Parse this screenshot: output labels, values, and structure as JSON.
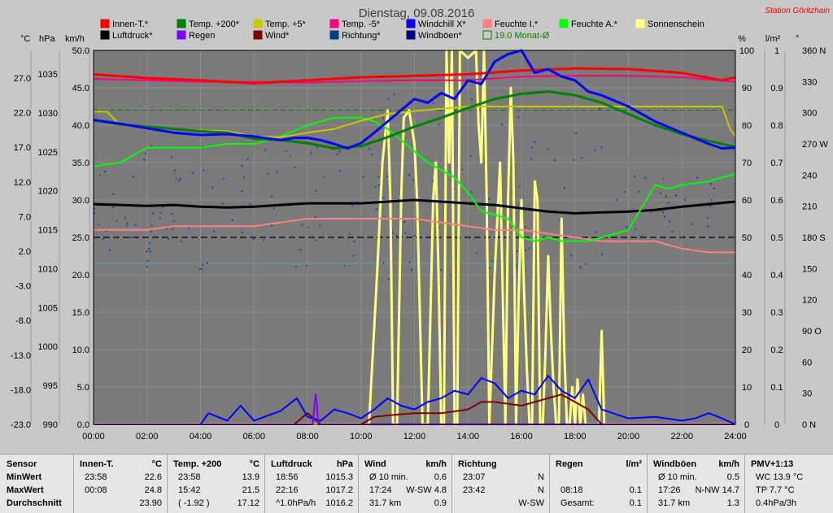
{
  "chart_data": {
    "type": "line",
    "title": "Dienstag, 09.08.2016",
    "station": "Station Göritzhain",
    "x_ticks": [
      "00:00",
      "02:00",
      "04:00",
      "06:00",
      "08:00",
      "10:00",
      "12:00",
      "14:00",
      "16:00",
      "18:00",
      "20:00",
      "22:00",
      "24:00"
    ],
    "axes": {
      "celsius": {
        "unit": "°C",
        "ticks": [
          "27.0",
          "22.0",
          "17.0",
          "12.0",
          "7.0",
          "2.0",
          "-3.0",
          "-8.0",
          "-13.0",
          "-18.0",
          "-23.0"
        ]
      },
      "hpa": {
        "unit": "hPa",
        "ticks": [
          "1035",
          "1030",
          "1025",
          "1020",
          "1015",
          "1010",
          "1005",
          "1000",
          "995",
          "990"
        ]
      },
      "kmh": {
        "unit": "km/h",
        "ticks": [
          "50.0",
          "45.0",
          "40.0",
          "35.0",
          "30.0",
          "25.0",
          "20.0",
          "15.0",
          "10.0",
          "5.0",
          "0.0"
        ]
      },
      "percent": {
        "unit": "%",
        "ticks": [
          "100",
          "90",
          "80",
          "70",
          "60",
          "50",
          "40",
          "30",
          "20",
          "10",
          "0"
        ]
      },
      "rain": {
        "unit": "l/m²",
        "ticks": [
          "1",
          "0.9",
          "0.8",
          "0.7",
          "0.6",
          "0.5",
          "0.4",
          "0.3",
          "0.2",
          "0.1",
          "0"
        ]
      },
      "direction": {
        "unit": "°",
        "ticks": [
          "360 N",
          "330",
          "300",
          "270 W",
          "240",
          "210",
          "180 S",
          "150",
          "120",
          "90 O",
          "60",
          "30",
          "0 N"
        ]
      }
    },
    "legend": [
      {
        "name": "Innen-T.*",
        "color": "#ff0000"
      },
      {
        "name": "Temp. +200*",
        "color": "#008000"
      },
      {
        "name": "Temp. +5*",
        "color": "#c8c800"
      },
      {
        "name": "Temp. -5*",
        "color": "#ff0080"
      },
      {
        "name": "Windchill X*",
        "color": "#0000ff"
      },
      {
        "name": "Feuchte I.*",
        "color": "#ff8080"
      },
      {
        "name": "Feuchte A.*",
        "color": "#00ff00"
      },
      {
        "name": "Sonnenschein",
        "color": "#ffff80"
      },
      {
        "name": "Luftdruck*",
        "color": "#000000"
      },
      {
        "name": "Regen",
        "color": "#8000ff"
      },
      {
        "name": "Wind*",
        "color": "#800000"
      },
      {
        "name": "Richtung*",
        "color": "#004080"
      },
      {
        "name": "Windböen*",
        "color": "#000080"
      },
      {
        "name": "19.0 Monat-Ø",
        "color": "#008000"
      }
    ],
    "series": [
      {
        "name": "Innen-T.*",
        "axis": "celsius",
        "color": "#ff0000",
        "x": [
          0,
          2,
          4,
          6,
          8,
          10,
          12,
          14,
          16,
          18,
          20,
          22,
          23.5,
          24
        ],
        "values": [
          23.8,
          23.3,
          23.0,
          22.6,
          23.0,
          23.4,
          23.6,
          23.8,
          24.3,
          24.6,
          24.5,
          24.0,
          23.0,
          23.4
        ]
      },
      {
        "name": "Temp. -5*",
        "axis": "celsius",
        "color": "#ff0080",
        "x": [
          0,
          2,
          4,
          6,
          8,
          10,
          12,
          14,
          16,
          18,
          20,
          22,
          24
        ],
        "values": [
          23.2,
          23.0,
          22.8,
          22.8,
          22.7,
          22.9,
          23.0,
          23.0,
          23.5,
          23.6,
          23.6,
          23.4,
          22.8
        ]
      },
      {
        "name": "Temp. +5*",
        "axis": "celsius",
        "color": "#c8c800",
        "x": [
          0,
          0.5,
          1,
          2,
          3,
          4,
          5,
          6,
          7,
          8,
          9,
          10,
          11,
          12,
          13,
          14,
          15,
          16,
          17,
          18,
          19,
          20,
          21,
          22,
          23.5,
          23.8,
          24
        ],
        "values": [
          18.8,
          18.8,
          17.0,
          16.8,
          16.5,
          16.3,
          16.2,
          15.5,
          15.4,
          16.0,
          16.5,
          17.6,
          18.5,
          18.9,
          19.2,
          19.5,
          19.5,
          19.5,
          19.5,
          19.5,
          19.5,
          19.5,
          19.5,
          19.5,
          19.5,
          16.5,
          15.5
        ]
      },
      {
        "name": "Temp. +200*",
        "axis": "celsius",
        "color": "#008000",
        "x": [
          0,
          1,
          2,
          3,
          4,
          5,
          6,
          7,
          8,
          9,
          10,
          11,
          12,
          13,
          14,
          15,
          16,
          17,
          18,
          19,
          20,
          21,
          22,
          23,
          24
        ],
        "values": [
          17.7,
          17.1,
          16.8,
          16.5,
          16.2,
          16.0,
          15.2,
          15.0,
          14.6,
          13.9,
          14.2,
          15.4,
          16.8,
          18.0,
          19.3,
          20.5,
          21.2,
          21.5,
          21.0,
          20.0,
          18.5,
          17.0,
          15.8,
          14.9,
          14.1
        ]
      },
      {
        "name": "Windchill X*",
        "axis": "celsius",
        "color": "#0000ff",
        "x": [
          0,
          1,
          2,
          3,
          4,
          5,
          6,
          7,
          7.5,
          8,
          8.5,
          9,
          9.5,
          10,
          10.5,
          11,
          11.5,
          12,
          12.5,
          13,
          13.5,
          14,
          14.5,
          15,
          15.5,
          16,
          16.5,
          17,
          17.5,
          18,
          18.5,
          19,
          20,
          21,
          22,
          23,
          23.5,
          24
        ],
        "values": [
          17.7,
          17.2,
          16.6,
          16.0,
          15.7,
          15.8,
          15.5,
          15.0,
          15.3,
          15.3,
          15.0,
          14.5,
          13.9,
          14.6,
          16.0,
          17.5,
          19.0,
          20.5,
          20.0,
          21.3,
          20.5,
          23.0,
          22.5,
          25.5,
          26.5,
          27.0,
          24.0,
          24.5,
          23.5,
          23.0,
          21.5,
          21.0,
          19.5,
          17.5,
          16.0,
          14.5,
          13.9,
          14.0
        ]
      },
      {
        "name": "Feuchte A.*",
        "axis": "percent",
        "color": "#00ff00",
        "x": [
          0,
          1,
          2,
          3,
          4,
          5,
          6,
          7,
          8,
          9,
          10,
          10.5,
          11,
          11.5,
          12,
          12.5,
          13,
          13.5,
          14,
          14.5,
          15,
          15.5,
          16,
          16.5,
          17,
          17.5,
          18,
          18.5,
          19,
          20,
          20.5,
          21,
          21.5,
          22,
          23,
          24
        ],
        "values": [
          69,
          70,
          74,
          74,
          74,
          75,
          75,
          77,
          80,
          82,
          82,
          81,
          79,
          76,
          73,
          70,
          68,
          66,
          62,
          57,
          56,
          55,
          50,
          49,
          50,
          49,
          49,
          49,
          50,
          52,
          58,
          64,
          63,
          64,
          65,
          67
        ]
      },
      {
        "name": "Feuchte I.*",
        "axis": "percent",
        "color": "#ff8080",
        "x": [
          0,
          1,
          2,
          3,
          4,
          5,
          6,
          7,
          8,
          9,
          10,
          11,
          12,
          13,
          14,
          15,
          16,
          17,
          18,
          19,
          20,
          21,
          22,
          23,
          24
        ],
        "values": [
          52,
          52,
          52,
          53,
          53,
          53,
          53,
          54,
          55,
          55,
          55,
          55,
          55,
          54,
          53,
          52,
          52,
          51,
          50,
          49,
          49,
          49,
          47,
          46,
          46
        ]
      },
      {
        "name": "Luftdruck*",
        "axis": "hpa",
        "color": "#000000",
        "x": [
          0,
          1,
          2,
          3,
          4,
          5,
          6,
          7,
          8,
          9,
          10,
          11,
          12,
          13,
          14,
          15,
          16,
          17,
          18,
          19,
          20,
          21,
          22,
          23,
          24
        ],
        "values": [
          1016.5,
          1016.4,
          1016.3,
          1016.4,
          1016.2,
          1016.1,
          1016.2,
          1016.4,
          1016.6,
          1016.6,
          1016.6,
          1016.8,
          1017.0,
          1016.8,
          1016.6,
          1016.4,
          1016.0,
          1015.6,
          1015.4,
          1015.5,
          1015.6,
          1015.8,
          1016.2,
          1016.5,
          1016.8
        ]
      },
      {
        "name": "Sonnenschein",
        "axis": "percent",
        "color": "#ffff80",
        "x": [
          0,
          10.3,
          10.6,
          10.8,
          11.0,
          11.1,
          11.2,
          11.35,
          11.5,
          11.6,
          11.8,
          12.0,
          12.1,
          12.3,
          12.5,
          12.7,
          12.8,
          12.9,
          13.0,
          13.1,
          13.2,
          13.3,
          13.4,
          13.5,
          13.6,
          13.7,
          14.0,
          14.3,
          14.4,
          14.5,
          14.6,
          14.7,
          14.8,
          15.0,
          15.2,
          15.4,
          15.5,
          15.6,
          15.7,
          15.8,
          15.9,
          16.0,
          16.1,
          16.2,
          16.3,
          16.4,
          16.5,
          16.6,
          16.7,
          16.8,
          16.9,
          17.0,
          17.1,
          17.2,
          17.3,
          17.4,
          17.5,
          17.6,
          17.7,
          17.8,
          17.9,
          18.0,
          18.1,
          18.2,
          18.3,
          18.4,
          18.5,
          18.6,
          18.7,
          18.8,
          18.9,
          19.0,
          19.1,
          24
        ],
        "values": [
          0,
          0,
          40,
          70,
          84,
          60,
          0,
          0,
          60,
          82,
          84,
          75,
          60,
          0,
          0,
          60,
          70,
          40,
          0,
          0,
          100,
          70,
          100,
          0,
          0,
          100,
          98,
          100,
          80,
          70,
          100,
          60,
          0,
          40,
          70,
          0,
          60,
          90,
          70,
          0,
          35,
          60,
          35,
          15,
          0,
          0,
          65,
          60,
          0,
          0,
          20,
          45,
          25,
          10,
          0,
          0,
          55,
          20,
          0,
          0,
          10,
          0,
          12,
          0,
          8,
          0,
          0,
          0,
          0,
          0,
          0,
          25,
          0,
          0
        ]
      },
      {
        "name": "Windböen*",
        "axis": "kmh",
        "color": "#0000ff",
        "x": [
          0,
          2,
          3,
          4,
          4.3,
          5,
          5.5,
          6,
          7,
          7.6,
          8,
          8.5,
          9,
          9.5,
          10,
          10.5,
          11,
          11.5,
          12,
          12.5,
          13,
          13.5,
          14,
          14.5,
          15,
          15.5,
          16,
          16.5,
          17,
          17.5,
          18,
          18.5,
          19,
          20,
          21,
          22,
          22.5,
          23,
          23.5,
          24
        ],
        "values": [
          0,
          0,
          0,
          0,
          1.5,
          0.5,
          2.5,
          0.5,
          1.8,
          3.5,
          1.0,
          0.5,
          2.0,
          1.5,
          0.8,
          2.0,
          3.5,
          2.5,
          2.0,
          3.0,
          3.5,
          4.5,
          4.0,
          6.2,
          5.5,
          3.5,
          4.5,
          4.0,
          6.5,
          4.5,
          3.5,
          6.0,
          2.0,
          0.8,
          1.0,
          0.5,
          0.8,
          1.5,
          0.8,
          0
        ]
      },
      {
        "name": "Wind*",
        "axis": "kmh",
        "color": "#800000",
        "x": [
          0,
          7.5,
          8.0,
          8.5,
          10,
          10.5,
          11,
          12,
          13,
          14,
          14.5,
          15,
          16,
          17,
          17.5,
          18,
          18.5,
          19,
          24
        ],
        "values": [
          0,
          0,
          1.5,
          0,
          0,
          1.0,
          1.2,
          1.5,
          1.5,
          2.0,
          3.0,
          3.0,
          2.5,
          3.5,
          4.0,
          3.0,
          2.0,
          0,
          0
        ]
      },
      {
        "name": "Regen",
        "axis": "rain",
        "color": "#8000ff",
        "x": [
          0,
          8.2,
          8.3,
          8.35,
          8.4,
          24
        ],
        "values": [
          0,
          0,
          0.08,
          0.06,
          0,
          0
        ]
      },
      {
        "name": "19.0 Monat-Ø",
        "axis": "celsius",
        "color": "#008000",
        "x": [
          0,
          24
        ],
        "values": [
          19.0,
          19.0
        ]
      }
    ],
    "richtung_ref_deg": 180,
    "monat_ref_kmh": 21.5
  },
  "stats": [
    {
      "hdr": "Sensor",
      "unit": "",
      "r1": [
        "MinWert"
      ],
      "r2": [
        "MaxWert"
      ],
      "r3": [
        "Durchschnitt"
      ]
    },
    {
      "hdr": "Innen-T.",
      "unit": "°C",
      "r1": [
        "23:58",
        "22.6"
      ],
      "r2": [
        "00:08",
        "24.8"
      ],
      "r3": [
        "",
        "23.90"
      ]
    },
    {
      "hdr": "Temp. +200",
      "unit": "°C",
      "r1": [
        "23:58",
        "13.9"
      ],
      "r2": [
        "15:42",
        "21.5"
      ],
      "r3": [
        "( -1.92 )",
        "17.12"
      ]
    },
    {
      "hdr": "Luftdruck",
      "unit": "hPa",
      "r1": [
        "18:56",
        "1015.3"
      ],
      "r2": [
        "22:16",
        "1017.2"
      ],
      "r3": [
        "^1.0hPa/h",
        "1016.2"
      ]
    },
    {
      "hdr": "Wind",
      "unit": "km/h",
      "r1": [
        "Ø 10 min.",
        "0.6"
      ],
      "r2": [
        "17:24",
        "W-SW 4.8"
      ],
      "r3": [
        "31.7 km",
        "0.9"
      ]
    },
    {
      "hdr": "Richtung",
      "unit": "",
      "r1": [
        "23:07",
        "N"
      ],
      "r2": [
        "23:42",
        "N"
      ],
      "r3": [
        "",
        "W-SW"
      ]
    },
    {
      "hdr": "Regen",
      "unit": "l/m²",
      "r1": [
        "",
        ""
      ],
      "r2": [
        "08:18",
        "0.1"
      ],
      "r3": [
        "Gesamt:",
        "0.1"
      ]
    },
    {
      "hdr": "Windböen",
      "unit": "km/h",
      "r1": [
        "Ø 10 min.",
        "0.5"
      ],
      "r2": [
        "17:26",
        "N-NW 14.7"
      ],
      "r3": [
        "31.7 km",
        "1.3"
      ]
    },
    {
      "hdr": "PMV+1:13",
      "unit": "",
      "r1": [
        "WC 13.9 °C"
      ],
      "r2": [
        "TP 7.7 °C"
      ],
      "r3": [
        "0.4hPa/3h"
      ]
    }
  ]
}
